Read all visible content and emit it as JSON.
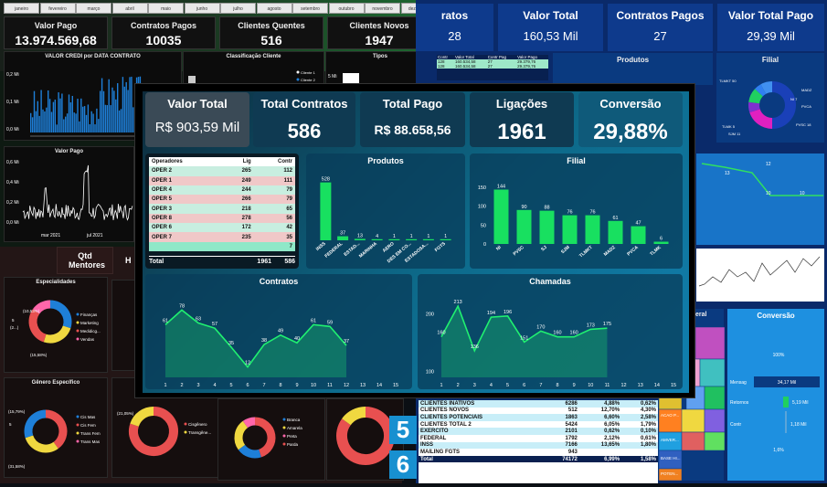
{
  "bg_left": {
    "months": [
      "janeiro",
      "fevereiro",
      "março",
      "abril",
      "maio",
      "junho",
      "julho",
      "agosto",
      "setembro",
      "outubro",
      "novembro",
      "dezembro"
    ],
    "kpis": [
      {
        "t": "Valor Pago",
        "v": "13.974.569,68"
      },
      {
        "t": "Contratos Pagos",
        "v": "10035"
      },
      {
        "t": "Clientes Quentes",
        "v": "516"
      },
      {
        "t": "Clientes Novos",
        "v": "1947"
      }
    ],
    "chart1_title": "VALOR CREDI por DATA CONTRATO",
    "chart2_title": "Classificação Cliente",
    "chart3_title": "Tipos",
    "chart4_title": "Valor Pago",
    "y1": [
      "0,2 Mi",
      "0,1 Mi",
      "0,0 Mi"
    ],
    "y2": [
      "0,6 Mi",
      "0,4 Mi",
      "0,2 Mi",
      "0,0 Mi"
    ],
    "x1": [
      "mar 2021",
      "jul 2021"
    ],
    "legend_cls": [
      "Cliente 1",
      "Cliente 2",
      "Cliente 3"
    ],
    "tipos_val": "5 Mi"
  },
  "bg_bottom": {
    "qtd_label": "Qtd Mentores",
    "h_label": "H",
    "esp_title": "Especialidades",
    "gen_title": "Gênero Específico",
    "esp_legend": [
      "Finanças",
      "Marketing",
      "Medidicg...",
      "Vendas"
    ],
    "esp_pct": [
      "(10,53%)",
      "5",
      "(2...)",
      "(15,58%)"
    ],
    "gen_legend": [
      "Cis Mas",
      "Cis Fem",
      "Trans Fem",
      "Trans Mas"
    ],
    "gen_pct": [
      "(15,79%)",
      "5",
      "(31,58%)"
    ],
    "donut3_pct": "(21,05%)",
    "donut3_legend": [
      "Cisgênero",
      "Transgêne..."
    ],
    "donut4_legend": [
      "Branca",
      "Amarela",
      "Preta",
      "Parda"
    ]
  },
  "bg_right": {
    "kpis": [
      {
        "t": "ratos",
        "v": "28"
      },
      {
        "t": "Valor Total",
        "v": "160,53 Mil"
      },
      {
        "t": "Contratos Pagos",
        "v": "27"
      },
      {
        "t": "Valor Total Pago",
        "v": "29,39 Mil"
      }
    ],
    "produtos_title": "Produtos",
    "filial_title": "Filial",
    "conversao_title": "Conversão",
    "eral_label": "eral",
    "mini_headers": [
      "Contr",
      "Valor Total",
      "Contr Pag",
      "Valor Pago"
    ],
    "mini_row1": [
      "128",
      "160.534,58",
      "27",
      "29.379,76"
    ],
    "mini_row2": [
      "128",
      "160.534,58",
      "27",
      "29.379,76"
    ],
    "filial_legend": [
      "TLMKT 50",
      "MADZ",
      "NI 7",
      "PVCA",
      "TLMK 5",
      "SJM 11",
      "PVSC 18"
    ],
    "line_labels": [
      "13",
      "12",
      "10",
      "10"
    ],
    "conv_labels": [
      "100%",
      "Mensag",
      "34,17 Mil",
      "Retornos",
      "5,19 Mil",
      "Contr",
      "1,18 Mil",
      "1,6%"
    ],
    "big_nums": [
      "5",
      "6"
    ],
    "bottom_rows": [
      [
        "CLIENTES INATIVOS",
        "6286",
        "4,88%",
        "0,62%"
      ],
      [
        "CLIENTES NOVOS",
        "512",
        "12,70%",
        "4,30%"
      ],
      [
        "CLIENTES POTENCIAIS",
        "1863",
        "6,60%",
        "2,58%"
      ],
      [
        "CLIENTES TOTAL 2",
        "5424",
        "6,05%",
        "1,79%"
      ],
      [
        "EXERCITO",
        "2101",
        "0,62%",
        "0,10%"
      ],
      [
        "FEDERAL",
        "1792",
        "2,12%",
        "0,61%"
      ],
      [
        "INSS",
        "7166",
        "13,65%",
        "1,80%"
      ],
      [
        "MAILING FGTS",
        "943",
        "",
        ""
      ]
    ],
    "bottom_total": [
      "Total",
      "74172",
      "6,99%",
      "1,58%"
    ],
    "treemap_labels": [
      "ACAO P...",
      "AMVER...",
      "BASE HI...",
      "POTEN..."
    ]
  },
  "main": {
    "kpis": [
      {
        "t": "Valor Total",
        "v": "R$ 903,59 Mil"
      },
      {
        "t": "Total Contratos",
        "v": "586"
      },
      {
        "t": "Total Pago",
        "v": "R$ 88.658,56"
      },
      {
        "t": "Ligações",
        "v": "1961"
      },
      {
        "t": "Conversão",
        "v": "29,88%"
      }
    ],
    "operadores": {
      "headers": [
        "Operadores",
        "Lig",
        "Contr"
      ],
      "rows": [
        [
          "OPER 2",
          "265",
          "112"
        ],
        [
          "OPER 1",
          "249",
          "111"
        ],
        [
          "OPER 4",
          "244",
          "79"
        ],
        [
          "OPER 5",
          "266",
          "79"
        ],
        [
          "OPER 3",
          "218",
          "65"
        ],
        [
          "OPER 8",
          "278",
          "56"
        ],
        [
          "OPER 6",
          "172",
          "42"
        ],
        [
          "OPER 7",
          "235",
          "35"
        ],
        [
          "",
          "",
          "7"
        ]
      ],
      "total": [
        "Total",
        "1961",
        "586"
      ]
    },
    "produtos": {
      "title": "Produtos"
    },
    "filial": {
      "title": "Filial"
    },
    "contratos": {
      "title": "Contratos"
    },
    "chamadas": {
      "title": "Chamadas"
    }
  },
  "chart_data": [
    {
      "type": "bar",
      "title": "Produtos",
      "categories": [
        "INSS",
        "FEDERAL",
        "ESTAD...",
        "MARINHA",
        "AERO",
        "DES EM CO...",
        "ESTADOSA...",
        "FGTS"
      ],
      "values": [
        528,
        37,
        13,
        4,
        1,
        1,
        1,
        1
      ],
      "ylim": [
        0,
        600
      ]
    },
    {
      "type": "bar",
      "title": "Filial",
      "categories": [
        "NI",
        "PVSC",
        "SJ",
        "SJM",
        "TLMKT",
        "MADZ",
        "PVCA",
        "TLMK"
      ],
      "values": [
        144,
        90,
        88,
        76,
        76,
        61,
        47,
        6
      ],
      "yticks": [
        0,
        50,
        100,
        150
      ],
      "ylim": [
        0,
        150
      ]
    },
    {
      "type": "area",
      "title": "Contratos",
      "x": [
        1,
        2,
        3,
        4,
        5,
        6,
        7,
        8,
        9,
        10,
        11,
        12,
        13,
        14,
        15
      ],
      "values": [
        61,
        78,
        63,
        57,
        35,
        12,
        38,
        49,
        40,
        61,
        59,
        37
      ],
      "xticks": [
        1,
        3,
        5,
        7,
        9,
        11,
        13,
        15
      ],
      "ylim": [
        0,
        90
      ]
    },
    {
      "type": "area",
      "title": "Chamadas",
      "x": [
        1,
        2,
        3,
        4,
        5,
        6,
        7,
        8,
        9,
        10,
        11,
        12,
        13,
        14,
        15
      ],
      "values": [
        160,
        213,
        136,
        194,
        196,
        151,
        170,
        160,
        160,
        173,
        175
      ],
      "xticks": [
        1,
        3,
        5,
        7,
        9,
        11,
        13,
        15
      ],
      "yticks": [
        100,
        200
      ],
      "ylim": [
        90,
        240
      ]
    }
  ]
}
